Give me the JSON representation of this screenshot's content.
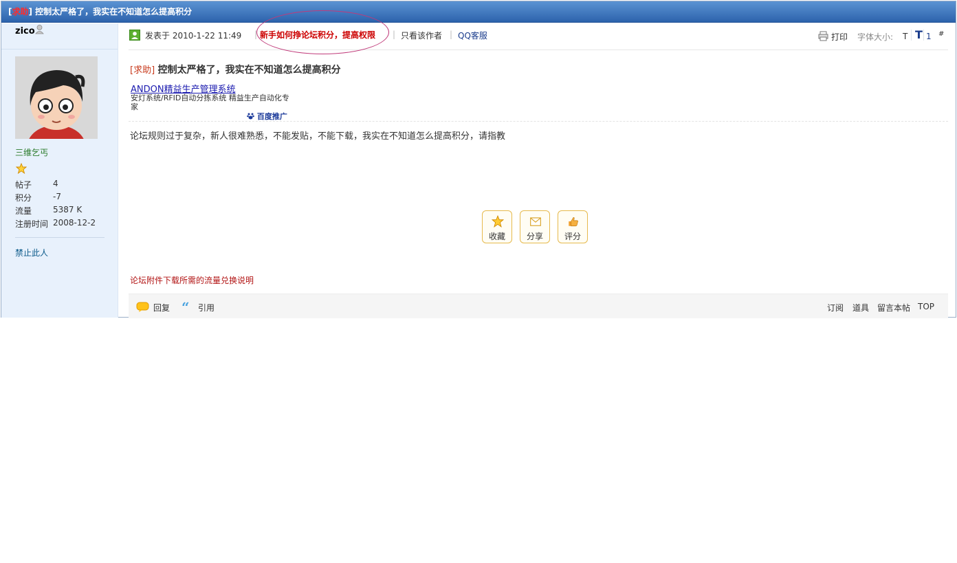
{
  "header": {
    "tag": "求助",
    "title": "控制太严格了，我实在不知道怎么提高积分"
  },
  "author": {
    "username": "zico",
    "rank": "三维乞丐",
    "stats": [
      {
        "label": "帖子",
        "value": "4"
      },
      {
        "label": "积分",
        "value": "-7"
      },
      {
        "label": "流量",
        "value": "5387 K"
      },
      {
        "label": "注册时间",
        "value": "2008-12-2"
      }
    ],
    "ban_link": "禁止此人"
  },
  "meta": {
    "posted_at": "发表于  2010-1-22 11:49",
    "highlight_link": "新手如何挣论坛积分，提高权限",
    "only_author": "只看该作者",
    "qq_service": "QQ客服",
    "print": "打印",
    "font_size_label": "字体大小:",
    "font_small": "T",
    "font_large": "T",
    "floor": "1",
    "floor_hash": "#"
  },
  "post": {
    "subject_tag": "求助",
    "subject": "控制太严格了，我实在不知道怎么提高积分",
    "ad_title": "ANDON精益生产管理系统",
    "ad_desc": "安灯系统/RFID自动分拣系统 精益生产自动化专家",
    "ad_source": "百度推广",
    "content": "论坛规则过于复杂，新人很难熟悉，不能发贴，不能下载，我实在不知道怎么提高积分，请指教"
  },
  "actions": {
    "favorite": "收藏",
    "share": "分享",
    "rate": "评分"
  },
  "notice": "论坛附件下载所需的流量兑换说明",
  "footer": {
    "reply": "回复",
    "quote": "引用",
    "subscribe": "订阅",
    "tools": "道具",
    "comment": "留言本帖",
    "top": "TOP"
  },
  "colors": {
    "titlebar": "#2d63ac",
    "sidebar": "#e8f1fc",
    "highlight": "#cc0000",
    "link": "#1a3c8c"
  }
}
